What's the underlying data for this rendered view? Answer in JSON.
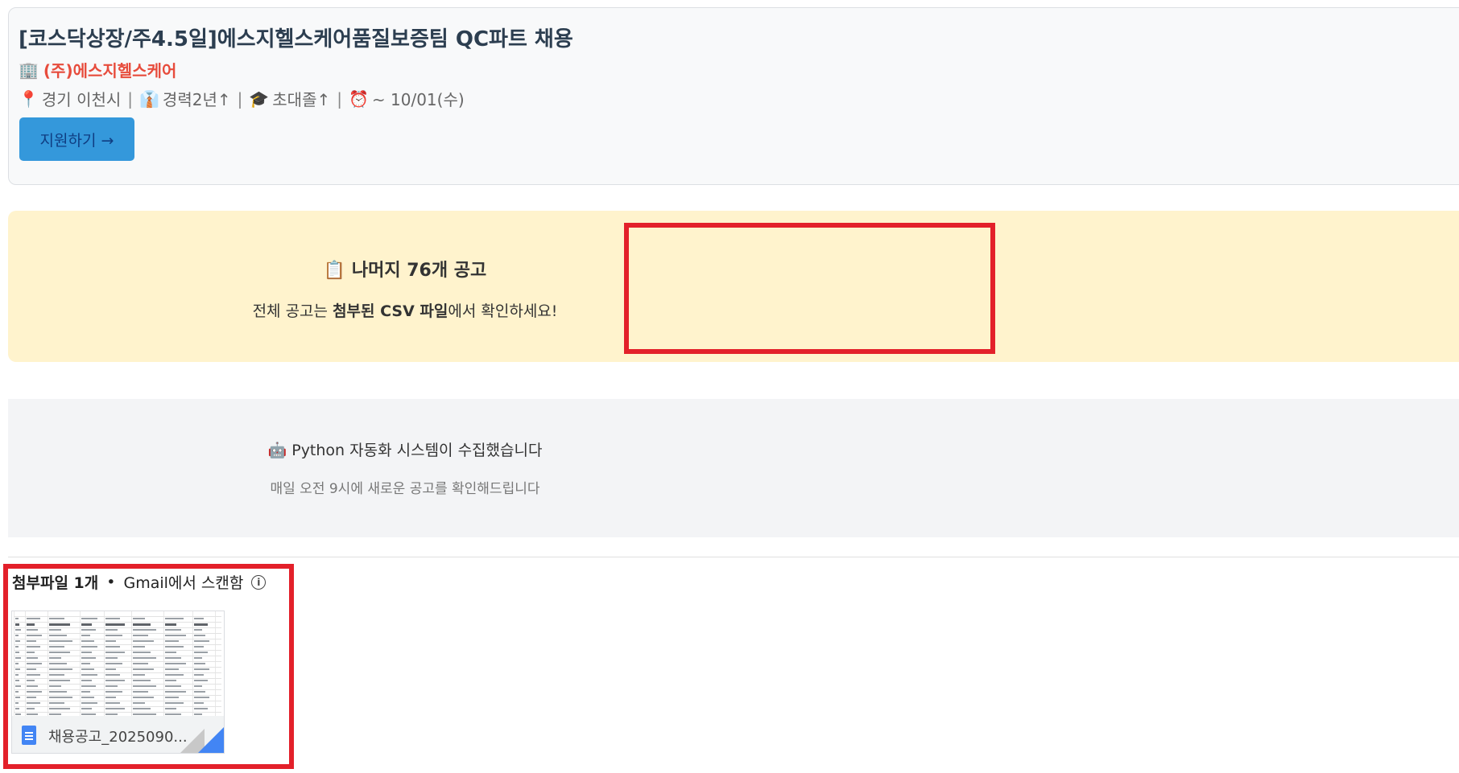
{
  "job": {
    "title": "[코스닥상장/주4.5일]에스지헬스케어품질보증팀 QC파트 채용",
    "company_icon": "🏢",
    "company": "(주)에스지헬스케어",
    "meta": [
      {
        "icon": "📍",
        "icon_name": "pin-icon",
        "text": "경기 이천시"
      },
      {
        "icon": "👔",
        "icon_name": "tie-icon",
        "text": "경력2년↑"
      },
      {
        "icon": "🎓",
        "icon_name": "graduation-cap-icon",
        "text": "초대졸↑"
      },
      {
        "icon": "⏰",
        "icon_name": "alarm-clock-icon",
        "text": "~ 10/01(수)"
      }
    ],
    "separator": "|",
    "apply_label": "지원하기 →"
  },
  "notice": {
    "title_icon": "📋",
    "title": "나머지 76개 공고",
    "text_before": "전체 공고는 ",
    "text_bold": "첨부된 CSV 파일",
    "text_after": "에서 확인하세요!"
  },
  "footer": {
    "icon": "🤖",
    "title": "Python 자동화 시스템이 수집했습니다",
    "subtitle": "매일 오전 9시에 새로운 공고를 확인해드립니다"
  },
  "attachments": {
    "count_label": "첨부파일 1개",
    "dot": "•",
    "scan_label": "Gmail에서 스캔함",
    "info_glyph": "i",
    "file_name": "채용공고_2025090..."
  },
  "colors": {
    "company": "#e74c3c",
    "apply_button": "#3498db",
    "notice_bg": "#fff3cd",
    "highlight": "#e3202a",
    "doc_icon": "#4285f4"
  }
}
